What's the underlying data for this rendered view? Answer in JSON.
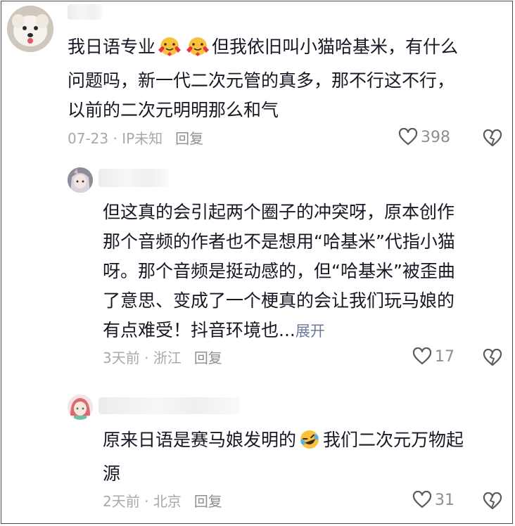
{
  "comments": [
    {
      "text_lines": [
        "我日语专业",
        "但我依旧叫小猫哈基米，有什么",
        "问题吗，新一代二次元管的真多，那不行这不行，",
        "以前的二次元明明那么和气"
      ],
      "date": "07-23",
      "location": "IP未知",
      "reply_label": "回复",
      "likes": "398"
    },
    {
      "text_lines": [
        "但这真的会引起两个圈子的冲突呀，原本创作",
        "那个音频的作者也不是想用“哈基米”代指小猫",
        "呀。那个音频是挺动感的，但“哈基米”被歪曲",
        "了意思、变成了一个梗真的会让我们玩马娘的",
        "有点难受！抖音环境也..."
      ],
      "expand_label": "展开",
      "date": "3天前",
      "location": "浙江",
      "reply_label": "回复",
      "likes": "17"
    },
    {
      "text_lines": [
        "原来日语是赛马娘发明的",
        "我们二次元万物起",
        "源"
      ],
      "date": "2天前",
      "location": "北京",
      "reply_label": "回复",
      "likes": "31"
    }
  ],
  "meta_separator": " · ",
  "icons": [
    "heart-icon",
    "dislike-heart-icon",
    "smiling-face-with-hearts-emoji",
    "rolling-on-floor-laughing-emoji"
  ]
}
